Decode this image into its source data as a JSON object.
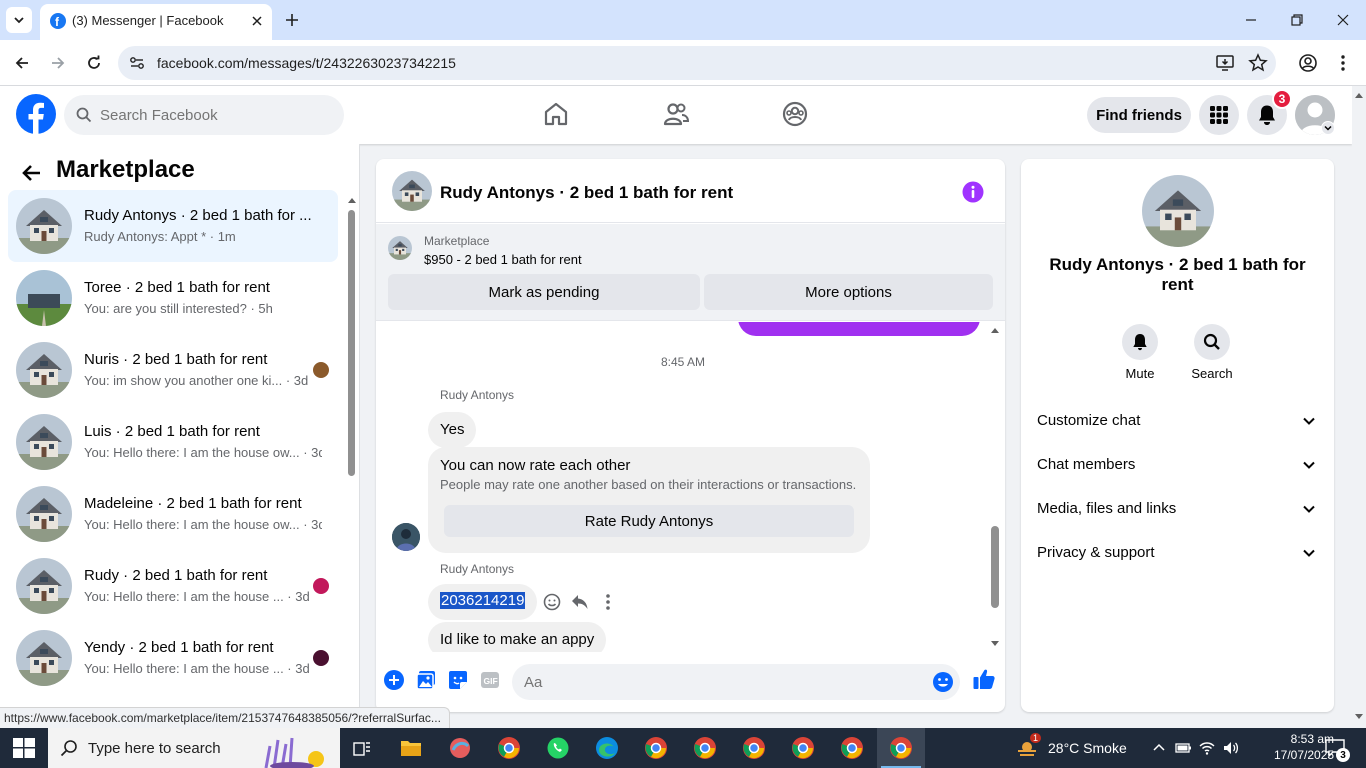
{
  "browser": {
    "tab_title": "(3) Messenger | Facebook",
    "url": "facebook.com/messages/t/24322630237342215",
    "status_url": "https://www.facebook.com/marketplace/item/2153747648385056/?referralSurfac..."
  },
  "fb_nav": {
    "search_placeholder": "Search Facebook",
    "find_friends_label": "Find friends",
    "notification_count": "3"
  },
  "left": {
    "title": "Marketplace",
    "conversations": [
      {
        "name": "Rudy Antonys · 2 bed 1 bath for ...",
        "snippet": "Rudy Antonys: Appt * · 1m",
        "active": true
      },
      {
        "name": "Toree · 2 bed 1 bath for rent",
        "snippet": "You: are you still interested? · 5h"
      },
      {
        "name": "Nuris · 2 bed 1 bath for rent",
        "snippet": "You: im show you another one ki... · 3d"
      },
      {
        "name": "Luis · 2 bed 1 bath for rent",
        "snippet": "You: Hello there: I am the house ow... · 3d"
      },
      {
        "name": "Madeleine · 2 bed 1 bath for rent",
        "snippet": "You: Hello there: I am the house ow... · 3d"
      },
      {
        "name": "Rudy · 2 bed 1 bath for rent",
        "snippet": "You: Hello there: I am the house ... · 3d"
      },
      {
        "name": "Yendy · 2 bed 1 bath for rent",
        "snippet": "You: Hello there: I am the house ... · 3d"
      }
    ]
  },
  "chat": {
    "title": "Rudy Antonys · 2 bed 1 bath for rent",
    "listing_source": "Marketplace",
    "listing_title": "$950 - 2 bed 1 bath for rent",
    "mark_pending_label": "Mark as pending",
    "more_options_label": "More options",
    "timestamp": "8:45 AM",
    "sender_name": "Rudy Antonys",
    "msg_yes": "Yes",
    "rate_title": "You can now rate each other",
    "rate_desc": "People may rate one another based on their interactions or transactions.",
    "rate_button": "Rate Rudy Antonys",
    "msg_phone": "2036214219",
    "msg_appy": "Id like to make an appy",
    "composer_placeholder": "Aa"
  },
  "info": {
    "name": "Rudy Antonys · 2 bed 1 bath for rent",
    "mute_label": "Mute",
    "search_label": "Search",
    "sections": [
      "Customize chat",
      "Chat members",
      "Media, files and links",
      "Privacy & support"
    ]
  },
  "taskbar": {
    "search_placeholder": "Type here to search",
    "weather": "28°C  Smoke",
    "weather_badge": "1",
    "time": "8:53 am",
    "date": "17/07/2025",
    "notif_count": "3"
  }
}
